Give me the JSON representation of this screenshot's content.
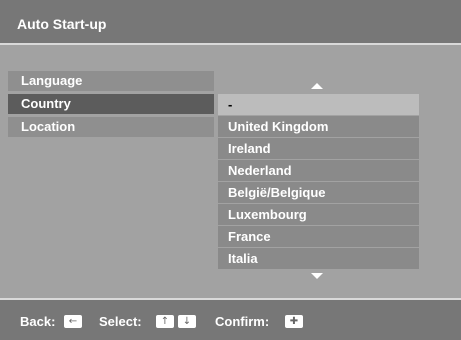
{
  "header": {
    "title": "Auto Start-up"
  },
  "menu": {
    "items": [
      {
        "label": "Language"
      },
      {
        "label": "Country"
      },
      {
        "label": "Location"
      }
    ],
    "selected": "Country"
  },
  "country_list": {
    "selected_value": "-",
    "options": [
      "United Kingdom",
      "Ireland",
      "Nederland",
      "België/Belgique",
      "Luxembourg",
      "France",
      "Italia"
    ],
    "scroll_up_icon": "triangle-up",
    "scroll_down_icon": "triangle-down"
  },
  "footer": {
    "back_label": "Back:",
    "select_label": "Select:",
    "confirm_label": "Confirm:",
    "back_key_icon": "left-arrow",
    "select_key_icons": [
      "up-arrow",
      "down-arrow"
    ],
    "confirm_key_icon": "enter-plus"
  },
  "colors": {
    "background": "#a2a2a2",
    "bar": "#777777",
    "menu_item": "#8f8f8f",
    "menu_item_active": "#5c5c5c",
    "option": "#8a8a8a",
    "option_selected": "#bcbcbc"
  }
}
